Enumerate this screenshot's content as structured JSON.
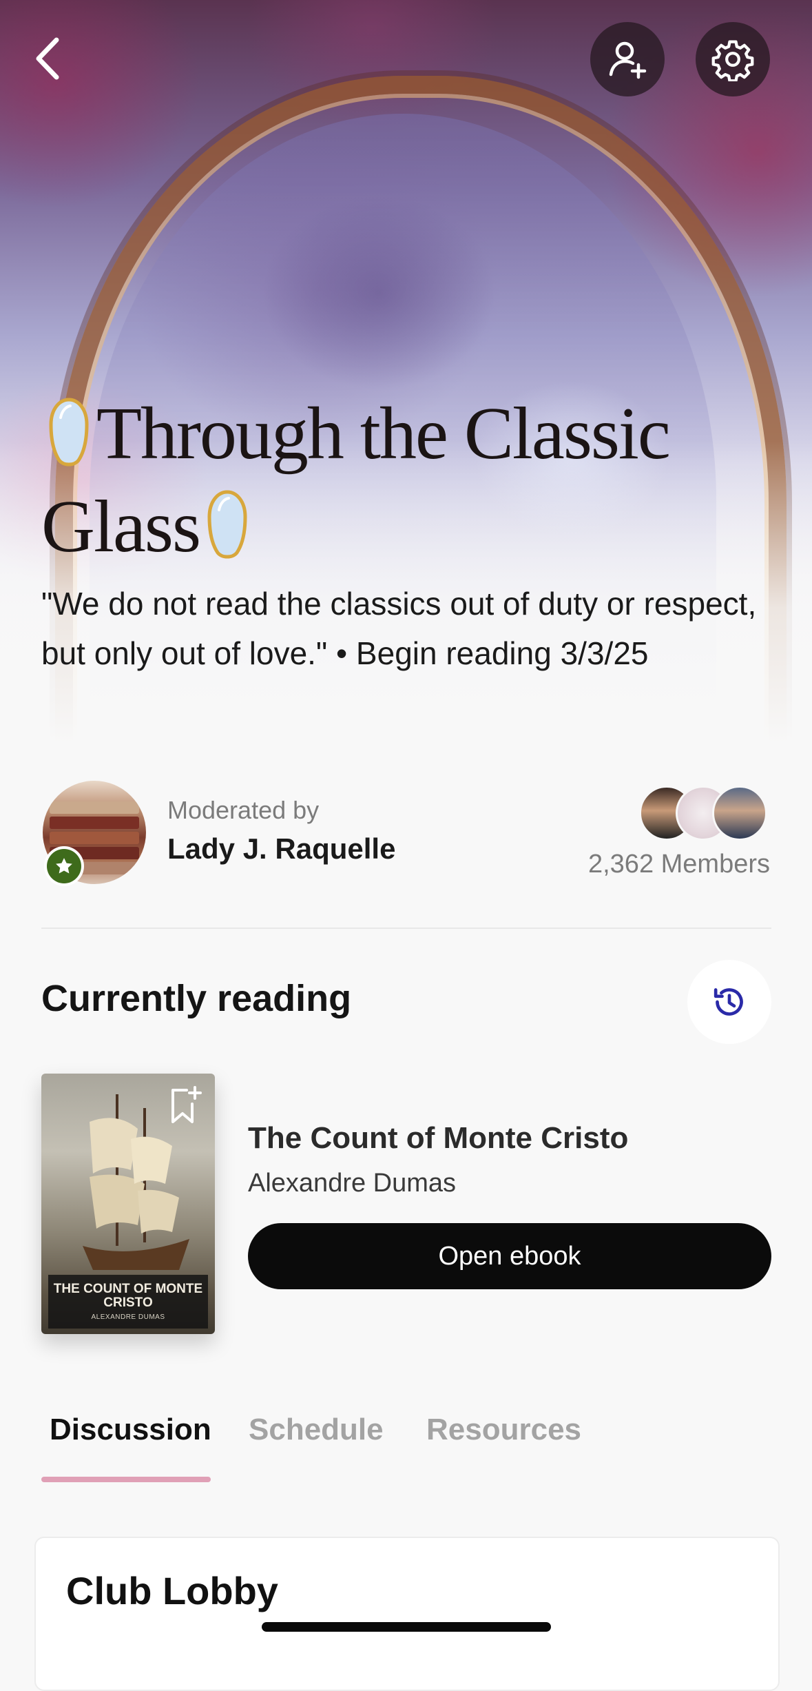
{
  "header": {
    "back_icon": "chevron-left-icon",
    "invite_icon": "add-person-icon",
    "settings_icon": "gear-icon"
  },
  "club": {
    "title_line1": "Through the Classic",
    "title_line2": "Glass",
    "title_decoration_icon": "mirror-icon",
    "description": "\"We do not read the classics out of duty or respect, but only out of love.\" • Begin reading 3/3/25"
  },
  "moderator": {
    "label": "Moderated by",
    "name": "Lady J. Raquelle",
    "badge_icon": "star-icon",
    "badge_color": "#3e6b1b"
  },
  "members": {
    "count_label": "2,362 Members"
  },
  "currently_reading": {
    "section_title": "Currently reading",
    "history_icon": "history-icon",
    "history_icon_color": "#2a2aa8",
    "book": {
      "title": "The Count of Monte Cristo",
      "author": "Alexandre Dumas",
      "cover_title": "THE COUNT OF MONTE CRISTO",
      "cover_author": "ALEXANDRE DUMAS",
      "bookmark_icon": "bookmark-add-icon",
      "open_button": "Open ebook"
    }
  },
  "tabs": [
    {
      "label": "Discussion",
      "active": true
    },
    {
      "label": "Schedule",
      "active": false
    },
    {
      "label": "Resources",
      "active": false
    }
  ],
  "tab_indicator_color": "#e0a0b6",
  "lobby": {
    "title": "Club Lobby"
  }
}
